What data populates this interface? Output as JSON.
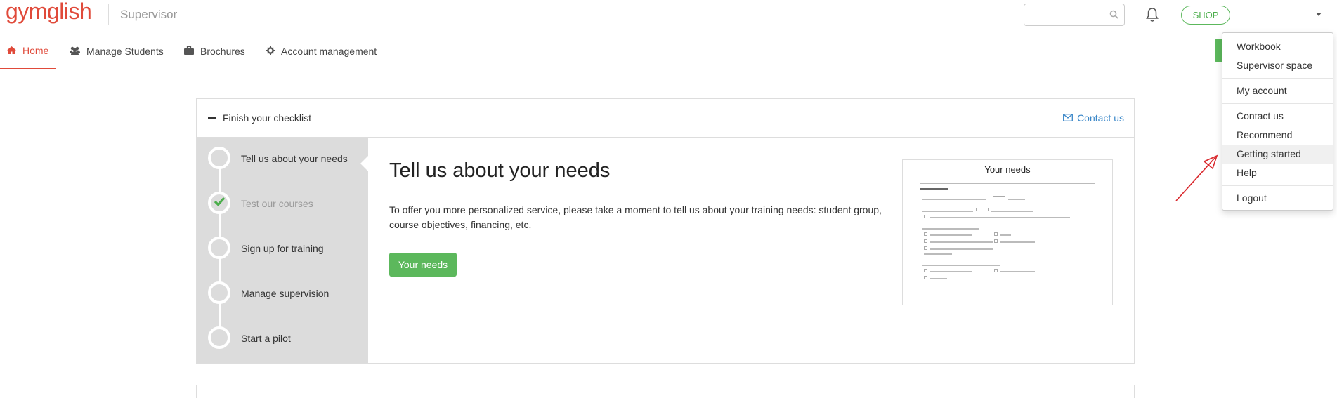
{
  "header": {
    "logo": "gymglish",
    "subtitle": "Supervisor",
    "search_placeholder": "",
    "shop_label": "SHOP"
  },
  "nav": {
    "items": [
      {
        "label": "Home",
        "icon": "home-icon"
      },
      {
        "label": "Manage Students",
        "icon": "users-icon"
      },
      {
        "label": "Brochures",
        "icon": "briefcase-icon"
      },
      {
        "label": "Account management",
        "icon": "gear-icon"
      }
    ]
  },
  "checklist": {
    "title": "Finish your checklist",
    "contact_label": "Contact us",
    "steps": [
      {
        "label": "Tell us about your needs",
        "done": false
      },
      {
        "label": "Test our courses",
        "done": true
      },
      {
        "label": "Sign up for training",
        "done": false
      },
      {
        "label": "Manage supervision",
        "done": false
      },
      {
        "label": "Start a pilot",
        "done": false
      }
    ],
    "content": {
      "title": "Tell us about your needs",
      "description": "To offer you more personalized service, please take a moment to tell us about your training needs: student group, course objectives, financing, etc.",
      "button_label": "Your needs"
    },
    "preview": {
      "title": "Your needs"
    }
  },
  "dropdown": {
    "items": [
      "Workbook",
      "Supervisor space",
      "My account",
      "Contact us",
      "Recommend",
      "Getting started",
      "Help",
      "Logout"
    ]
  },
  "colors": {
    "brand": "#e04a3a",
    "accent_green": "#5cb85c",
    "link": "#3a87c8",
    "annotation_arrow": "#d9262b"
  }
}
